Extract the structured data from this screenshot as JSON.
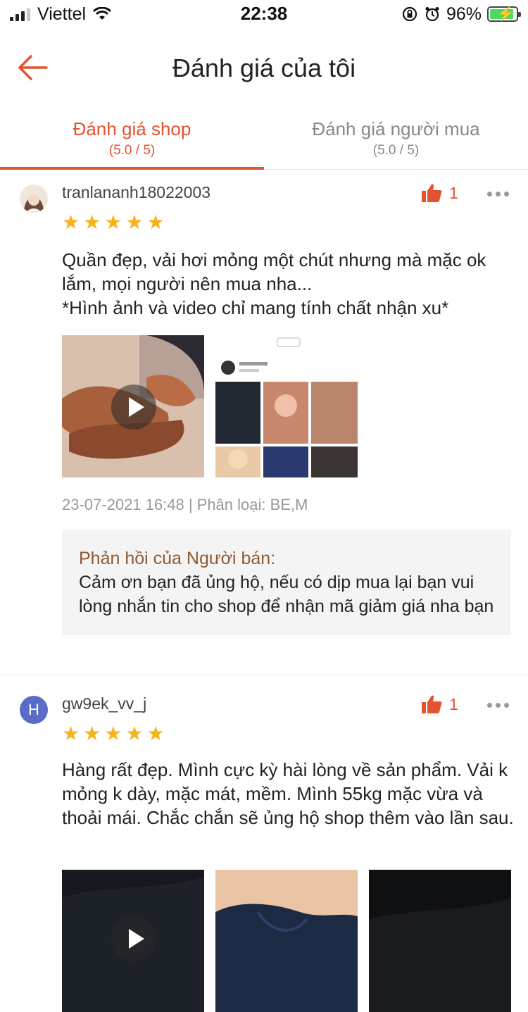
{
  "status_bar": {
    "carrier": "Viettel",
    "time": "22:38",
    "battery_percent": "96%",
    "signal_bars_filled": 3,
    "signal_bars_total": 4
  },
  "nav": {
    "title": "Đánh giá của tôi",
    "back_icon": "arrow-left-icon"
  },
  "tabs": [
    {
      "label": "Đánh giá shop",
      "sub": "(5.0 / 5)",
      "active": true
    },
    {
      "label": "Đánh giá người mua",
      "sub": "(5.0 / 5)",
      "active": false
    }
  ],
  "colors": {
    "accent": "#e5522f",
    "star": "#f9b21a",
    "reply_title": "#8d5a34",
    "avatar_h": "#5b6bc8"
  },
  "reviews": [
    {
      "username": "tranlananh18022003",
      "likes": "1",
      "rating": 5,
      "content_lines": [
        "Quần đẹp, vải hơi mỏng một chút nhưng mà mặc ok lắm, mọi người nên mua nha...",
        "*Hình ảnh và video chỉ mang tính chất nhận xu*"
      ],
      "media": [
        "video",
        "image"
      ],
      "meta": "23-07-2021 16:48 | Phân loại: BE,M",
      "seller_reply": {
        "title": "Phản hồi của Người bán:",
        "text": "Cảm ơn bạn đã ủng hộ, nếu có dịp mua lại bạn vui lòng nhắn tin cho shop để nhận mã giảm giá nha bạn"
      }
    },
    {
      "username": "gw9ek_vv_j",
      "avatar_letter": "H",
      "likes": "1",
      "rating": 5,
      "content": "Hàng rất đẹp. Mình cực kỳ hài lòng về sản phẩm. Vải k mỏng k dày, mặc mát, mềm. Mình 55kg mặc vừa và thoải mái. Chắc chắn sẽ ủng hộ shop thêm vào lần sau.",
      "media": [
        "video",
        "image",
        "image"
      ]
    }
  ]
}
